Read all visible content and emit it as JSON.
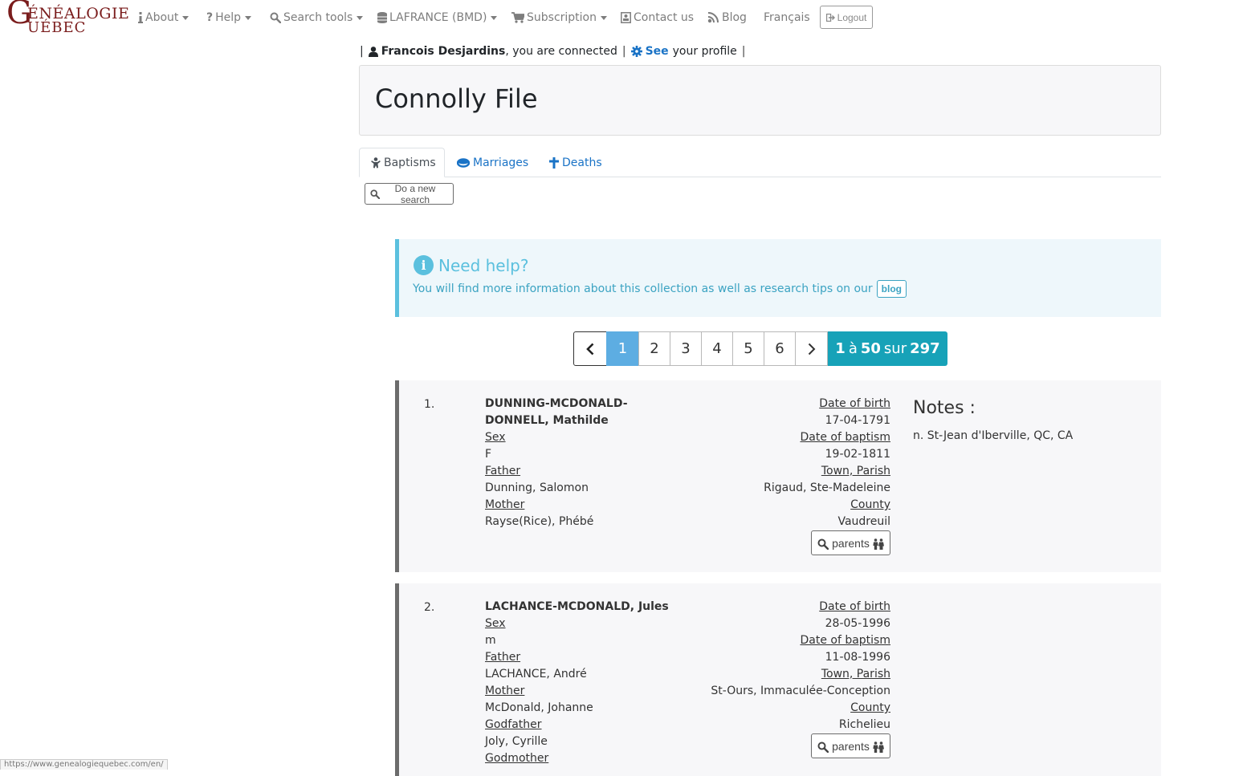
{
  "logo": {
    "initial": "G",
    "line1": "ÉNÉALOGIE",
    "line2": "UÉBEC"
  },
  "nav": {
    "about": "About",
    "help": "Help",
    "search_tools": "Search tools",
    "lafrance": "LAFRANCE (BMD)",
    "subscription": "Subscription",
    "contact": "Contact us",
    "blog": "Blog",
    "language": "Français",
    "logout": "Logout"
  },
  "connected": {
    "sep": "|",
    "user_name": "Francois Desjardins",
    "connected_text": ", you are connected",
    "see": "See",
    "profile_text": "your profile"
  },
  "page_title": "Connolly File",
  "tabs": {
    "baptisms": "Baptisms",
    "marriages": "Marriages",
    "deaths": "Deaths"
  },
  "new_search": "Do a new search",
  "help_box": {
    "title": "Need help?",
    "text": "You will find more information about this collection as well as research tips on our",
    "blog_button": "blog"
  },
  "pagination": {
    "pages": [
      "1",
      "2",
      "3",
      "4",
      "5",
      "6"
    ],
    "current": "1",
    "range_start": "1",
    "range_word": "à",
    "range_end": "50",
    "total_word": "sur",
    "total": "297"
  },
  "labels": {
    "sex": "Sex",
    "father": "Father",
    "mother": "Mother",
    "godfather": "Godfather",
    "godmother": "Godmother",
    "date_of_birth": "Date of birth",
    "date_of_baptism": "Date of baptism",
    "town_parish": "Town, Parish",
    "county": "County",
    "parents_button": "parents",
    "notes": "Notes :"
  },
  "records": [
    {
      "num": "1.",
      "name_line1": "DUNNING-MCDONALD-",
      "name_line2": "DONNELL, Mathilde",
      "sex": "F",
      "father": "Dunning, Salomon",
      "mother": "Rayse(Rice), Phébé",
      "date_of_birth": "17-04-1791",
      "date_of_baptism": "19-02-1811",
      "town_parish": "Rigaud, Ste-Madeleine",
      "county": "Vaudreuil",
      "notes": "n. St-Jean d'Iberville, QC, CA"
    },
    {
      "num": "2.",
      "name": "LACHANCE-MCDONALD, Jules",
      "sex": "m",
      "father": "LACHANCE, André",
      "mother": "McDonald, Johanne",
      "godfather": "Joly, Cyrille",
      "date_of_birth": "28-05-1996",
      "date_of_baptism": "11-08-1996",
      "town_parish": "St-Ours, Immaculée-Conception",
      "county": "Richelieu"
    }
  ],
  "status_url": "https://www.genealogiequebec.com/en/"
}
